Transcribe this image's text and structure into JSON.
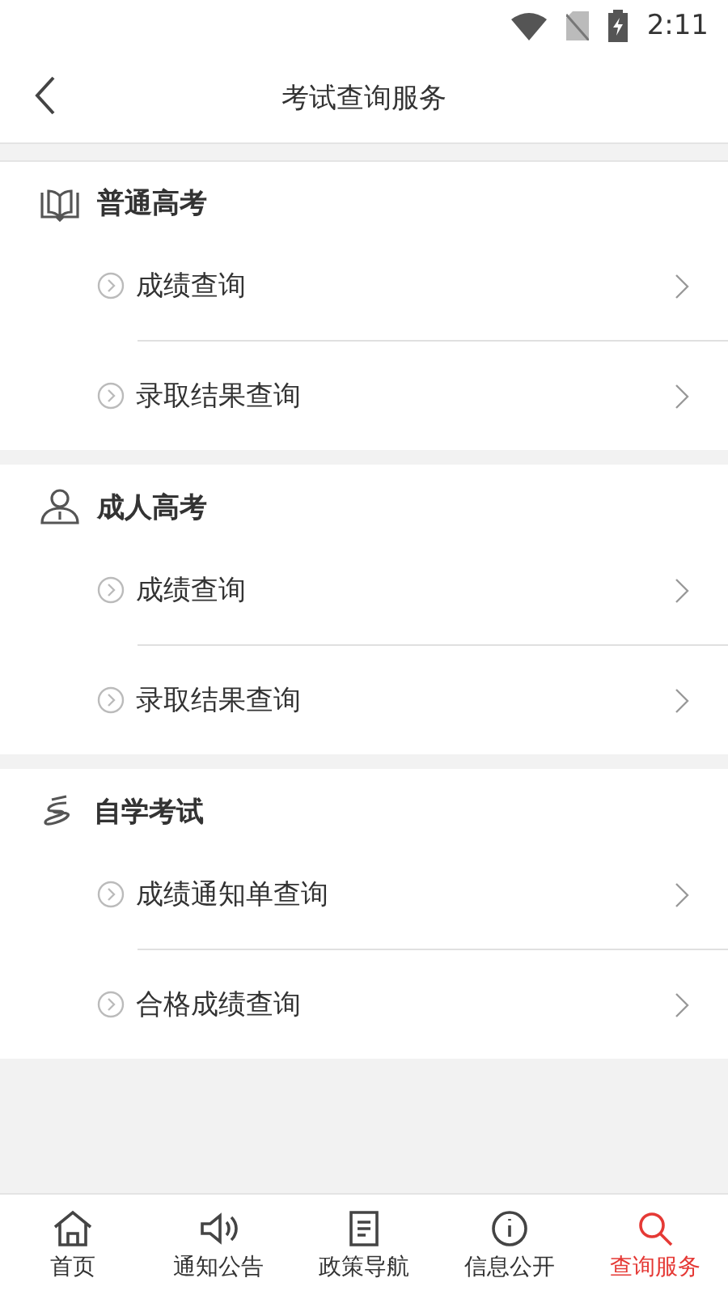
{
  "status_bar": {
    "time": "2:11"
  },
  "header": {
    "title": "考试查询服务"
  },
  "sections": [
    {
      "title": "普通高考",
      "items": [
        {
          "label": "成绩查询"
        },
        {
          "label": "录取结果查询"
        }
      ]
    },
    {
      "title": "成人高考",
      "items": [
        {
          "label": "成绩查询"
        },
        {
          "label": "录取结果查询"
        }
      ]
    },
    {
      "title": "自学考试",
      "items": [
        {
          "label": "成绩通知单查询"
        },
        {
          "label": "合格成绩查询"
        }
      ]
    }
  ],
  "tab_bar": [
    {
      "label": "首页",
      "selected": false
    },
    {
      "label": "通知公告",
      "selected": false
    },
    {
      "label": "政策导航",
      "selected": false
    },
    {
      "label": "信息公开",
      "selected": false
    },
    {
      "label": "查询服务",
      "selected": true
    }
  ]
}
